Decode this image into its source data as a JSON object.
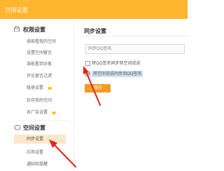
{
  "header": {
    "title": "空间设置"
  },
  "sidebar": {
    "section1": {
      "title": "权限设置",
      "items": [
        {
          "label": "谁能看我的空间"
        },
        {
          "label": "设置空间留言"
        },
        {
          "label": "谁能看到访客"
        },
        {
          "label": "评论留言过滤"
        },
        {
          "label": "隐身设置"
        },
        {
          "label": "封存我的空间"
        },
        {
          "label": "去广告设置"
        }
      ]
    },
    "section2": {
      "title": "空间设置",
      "items": [
        {
          "label": "同步设置"
        },
        {
          "label": "应用设置"
        },
        {
          "label": "通知和提醒"
        }
      ]
    }
  },
  "main": {
    "title": "同步设置",
    "qq_input": {
      "value": "同步QQ签名"
    },
    "option1": {
      "label": "将QQ签名同步到空间说说",
      "checked": false
    },
    "option2": {
      "label": "将空间说说同步到QQ签名",
      "checked": true
    },
    "save_label": "保存"
  },
  "colors": {
    "header_bg": "#ffb52e",
    "active_item_bg": "#fde7cb",
    "save_button_bg": "#f59a23",
    "badge": "#f5c600",
    "arrow": "#e0231b"
  }
}
